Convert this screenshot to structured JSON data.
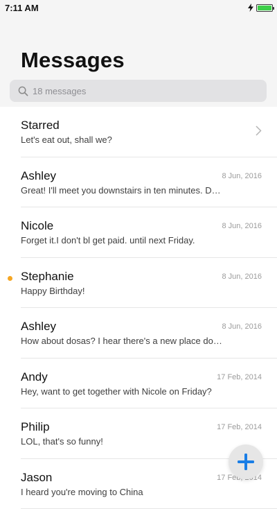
{
  "status_bar": {
    "time": "7:11 AM",
    "battery_level": 1.0,
    "charging": true,
    "battery_color": "#3ecf4a"
  },
  "header": {
    "title": "Messages"
  },
  "search": {
    "placeholder": "18 messages",
    "value": ""
  },
  "accent_color": "#1a7ee6",
  "unread_color": "#f5a623",
  "conversations": [
    {
      "name": "Starred",
      "preview": "Let's eat out, shall we?",
      "date": "",
      "unread": false,
      "chevron": true
    },
    {
      "name": "Ashley",
      "preview": "Great! I'll meet you downstairs in ten minutes. Don't be late!",
      "date": "8 Jun, 2016",
      "unread": false,
      "chevron": false
    },
    {
      "name": "Nicole",
      "preview": "Forget it.I don't bl get paid. until next Friday.",
      "date": "8 Jun, 2016",
      "unread": false,
      "chevron": false
    },
    {
      "name": "Stephanie",
      "preview": "Happy Birthday!",
      "date": "8 Jun, 2016",
      "unread": true,
      "chevron": false
    },
    {
      "name": "Ashley",
      "preview": "How about dosas? I hear there's a new place downtown.",
      "date": "8 Jun, 2016",
      "unread": false,
      "chevron": false
    },
    {
      "name": "Andy",
      "preview": "Hey, want to get together with Nicole on Friday?",
      "date": "17 Feb, 2014",
      "unread": false,
      "chevron": false
    },
    {
      "name": "Philip",
      "preview": "LOL, that's so funny!",
      "date": "17 Feb, 2014",
      "unread": false,
      "chevron": false
    },
    {
      "name": "Jason",
      "preview": "I heard you're moving to China",
      "date": "17 Feb, 2014",
      "unread": false,
      "chevron": false
    }
  ],
  "fab": {
    "icon": "plus-icon"
  }
}
